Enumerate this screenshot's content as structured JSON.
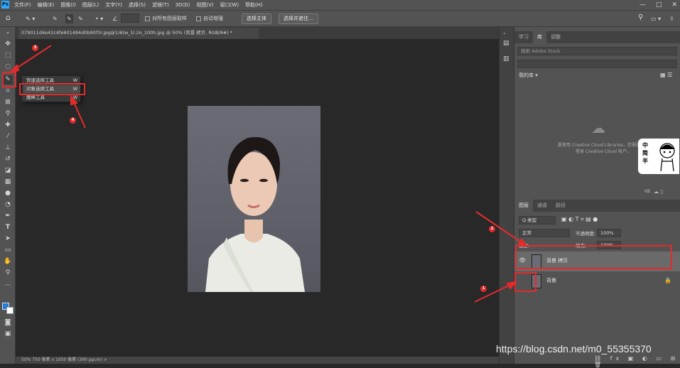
{
  "app": {
    "logo": "Ps",
    "menu": [
      "文件(F)",
      "编辑(E)",
      "图像(I)",
      "图层(L)",
      "文字(Y)",
      "选择(S)",
      "滤镜(T)",
      "3D(D)",
      "视图(V)",
      "窗口(W)",
      "帮助(H)"
    ],
    "window_controls": [
      "—",
      "□",
      "✕"
    ]
  },
  "options_bar": {
    "sample_label": "对所有图层取样",
    "enhance_label": "自动增强",
    "select_subject_btn": "选择主体",
    "select_mask_btn": "选择并遮住..."
  },
  "document_tab": {
    "title": "079011d4e41c4fe601494d0b90f3r.jpg@1/6tw_1l.2o_100h.jpg @ 50% (背景 拷贝, RGB/8#) *",
    "close": "×"
  },
  "flyout": {
    "items": [
      {
        "label": "快速选择工具",
        "key": "W"
      },
      {
        "label": "对象选择工具",
        "key": "W"
      },
      {
        "label": "魔棒工具",
        "key": "W"
      }
    ]
  },
  "status": {
    "text": "50%   750 像素 x 1050 像素 (300 ppcm)  >"
  },
  "right_panel": {
    "tabs_top": [
      "学习",
      "库",
      "调整"
    ],
    "search_placeholder": "搜索 Adobe Stock",
    "library_dropdown": "我的库",
    "cc_message": "要使用 Creative Cloud Libraries，您需要登录",
    "cc_message2": "登录 Creative Cloud 帐户。",
    "kb": "KB",
    "layers_tabs": [
      "图层",
      "通道",
      "路径"
    ],
    "kind_label": "Q 类型",
    "blend_mode": "正常",
    "opacity_label": "不透明度:",
    "opacity_value": "100%",
    "lock_label": "锁定:",
    "fill_label": "填充:",
    "fill_value": "100%",
    "layers": [
      {
        "name": "背景 拷贝",
        "visible": true
      },
      {
        "name": "背景",
        "visible": false
      }
    ]
  },
  "annotations": {
    "numbers": [
      "3",
      "4",
      "2",
      "1"
    ]
  },
  "sticker": {
    "text": [
      "中",
      "简",
      "半"
    ]
  },
  "watermark": "https://blog.csdn.net/m0_55355370",
  "colors": {
    "accent_red": "#e42b2b",
    "ps_blue": "#31a8ff",
    "panel": "#535353",
    "canvas": "#282828"
  }
}
